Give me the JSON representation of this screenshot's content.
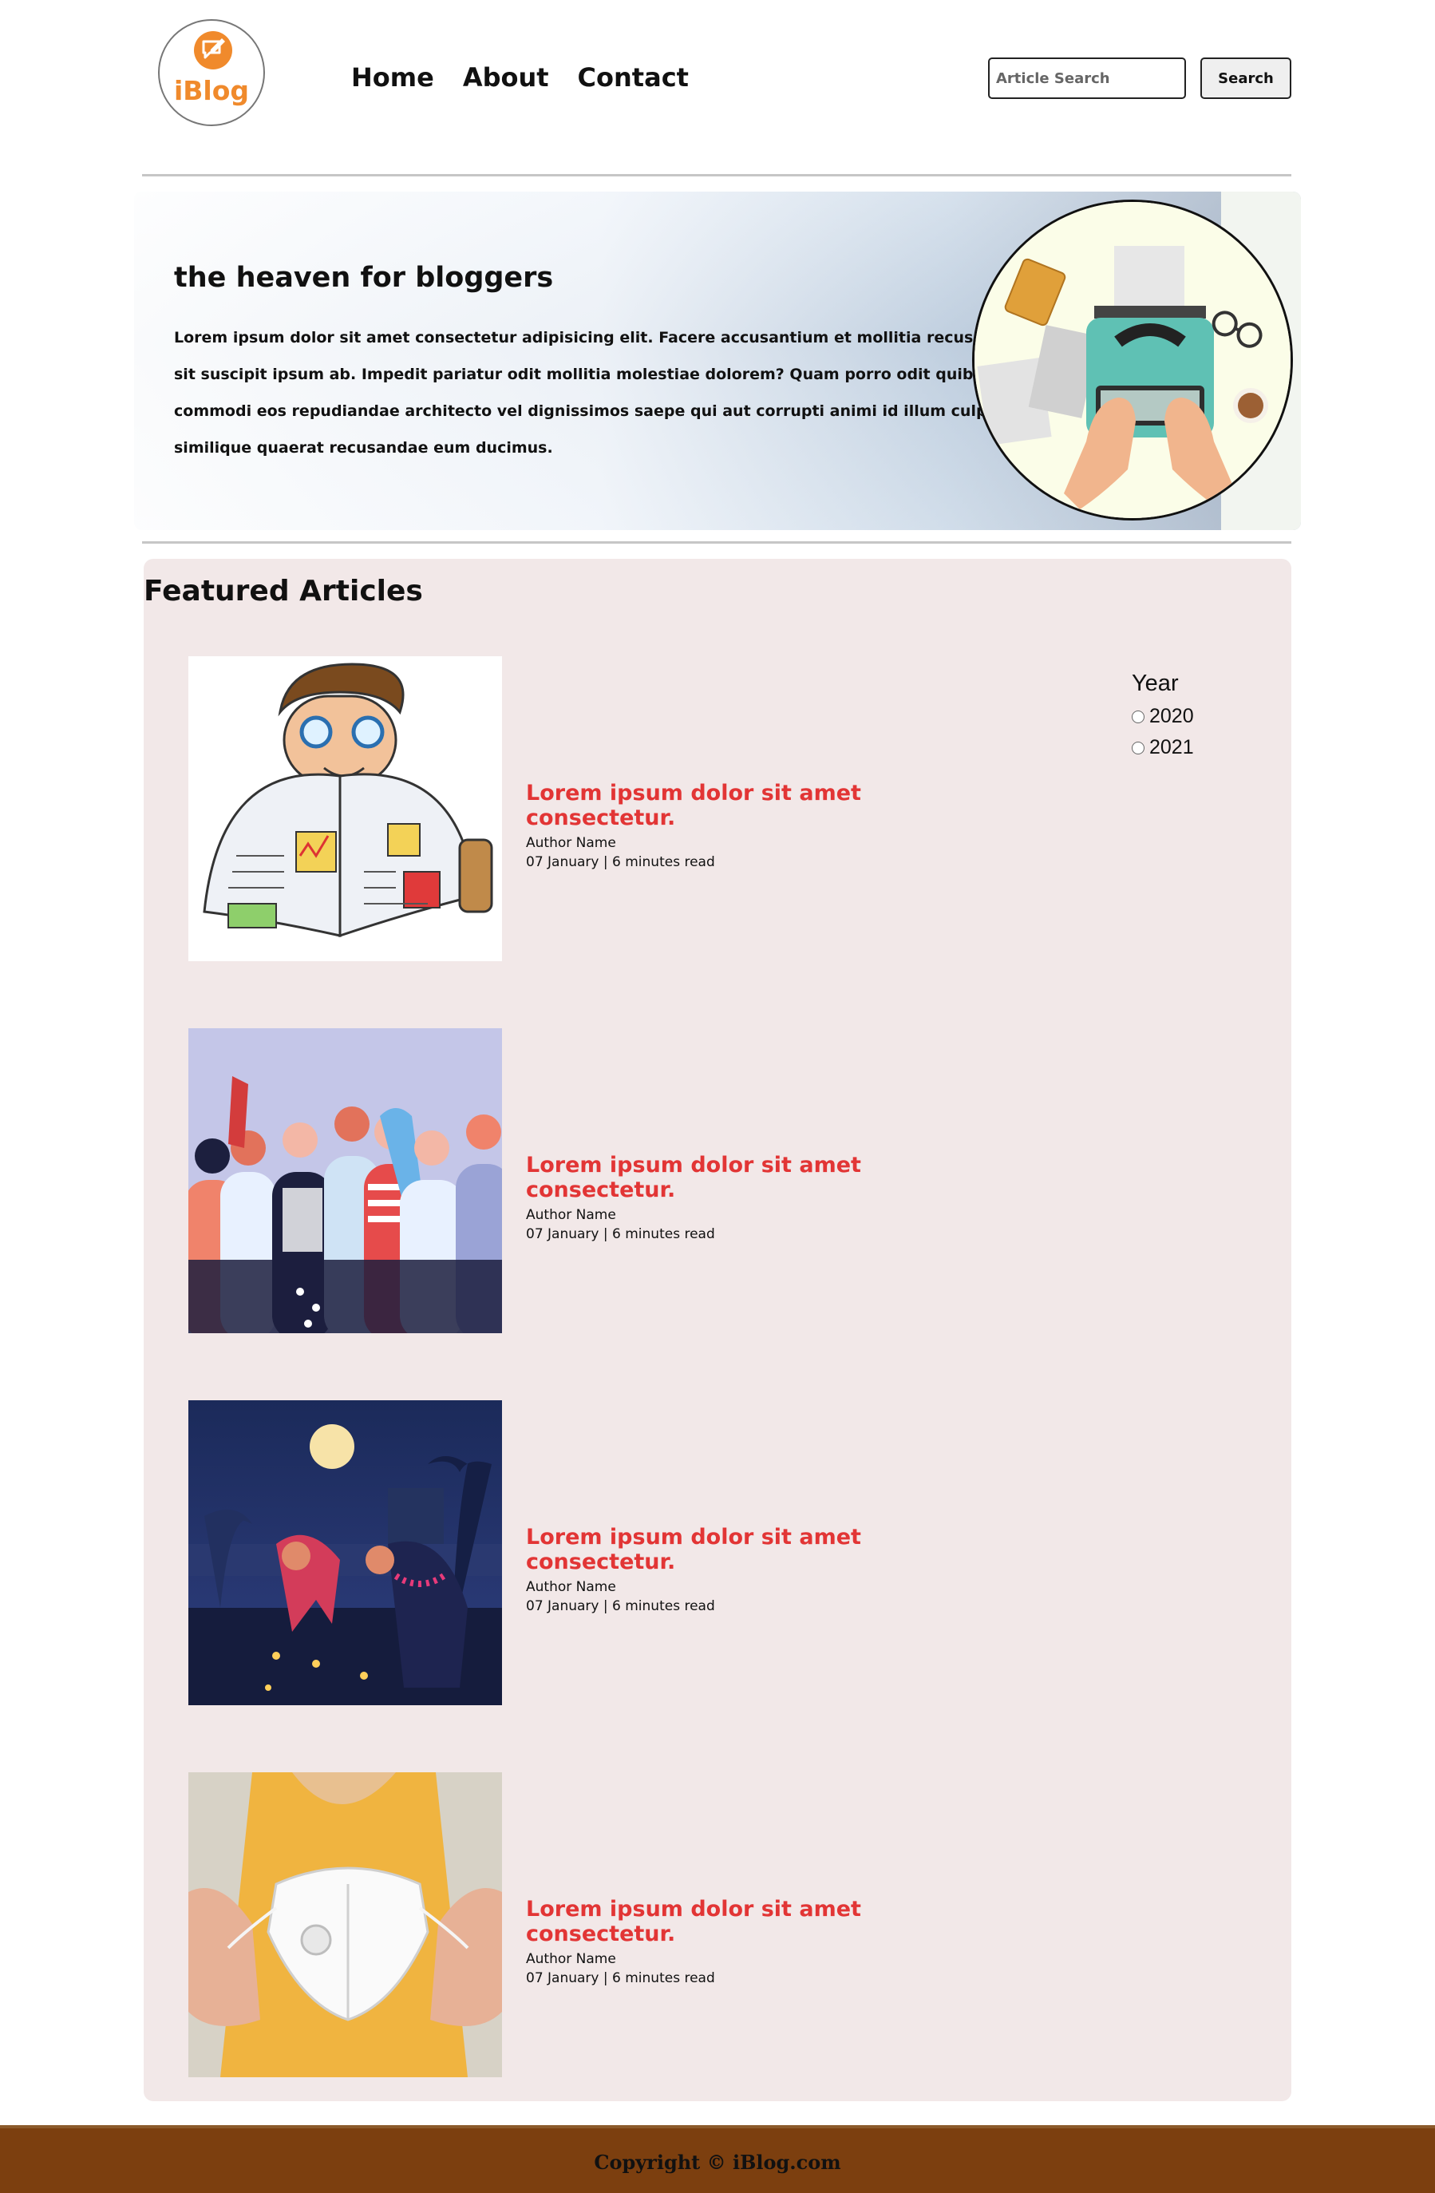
{
  "header": {
    "logo_text": "iBlog",
    "nav": [
      "Home",
      "About",
      "Contact"
    ],
    "search_placeholder": "Article Search",
    "search_button": "Search"
  },
  "hero": {
    "title": "the heaven for bloggers",
    "body": "Lorem ipsum dolor sit amet consectetur adipisicing elit. Facere accusantium et mollitia recusandae natus sit suscipit ipsum ab. Impedit pariatur odit mollitia molestiae dolorem? Quam porro odit quibusdam ut commodi eos repudiandae architecto vel dignissimos saepe qui aut corrupti animi id illum culpa, nemo vero similique quaerat recusandae eum ducimus."
  },
  "featured": {
    "title": "Featured Articles",
    "articles": [
      {
        "title": "Lorem ipsum dolor sit amet consectetur.",
        "author": "Author Name",
        "meta": "07 January | 6 minutes read",
        "image": "man-reading-newspaper"
      },
      {
        "title": "Lorem ipsum dolor sit amet consectetur.",
        "author": "Author Name",
        "meta": "07 January | 6 minutes read",
        "image": "crowd-wearing-masks"
      },
      {
        "title": "Lorem ipsum dolor sit amet consectetur.",
        "author": "Author Name",
        "meta": "07 January | 6 minutes read",
        "image": "people-lighting-diyas-at-night"
      },
      {
        "title": "Lorem ipsum dolor sit amet consectetur.",
        "author": "Author Name",
        "meta": "07 January | 6 minutes read",
        "image": "hands-holding-face-mask"
      }
    ],
    "filter": {
      "label": "Year",
      "options": [
        "2020",
        "2021"
      ]
    }
  },
  "footer": {
    "text": "Copyright © iBlog.com"
  },
  "colors": {
    "accent": "#e23535",
    "logo": "#f08a2c",
    "featured_bg": "#f2e8e8",
    "footer_bg": "#7c3f0f"
  }
}
